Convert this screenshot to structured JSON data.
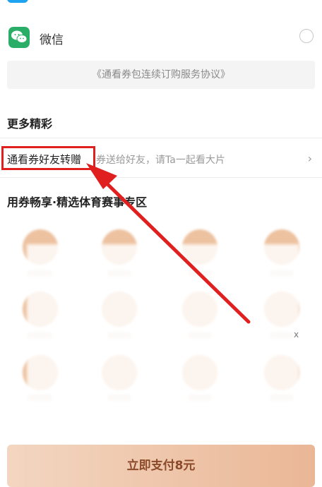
{
  "payment": {
    "wechat_label": "微信",
    "agreement_text": "《通看券包连续订购服务协议》"
  },
  "more": {
    "title": "更多精彩",
    "gift_title": "通看券好友转赠",
    "gift_desc": "券送给好友，请Ta一起看大片"
  },
  "sports": {
    "title": "用券畅享·精选体育赛事专区",
    "side_mark": "x"
  },
  "pay_button": {
    "label": "立即支付8元"
  },
  "colors": {
    "accent": "#e01f1f",
    "wechat": "#2aae67",
    "button": "#eab796"
  },
  "icons": {
    "wechat": "wechat-icon",
    "chevron": "chevron-right-icon",
    "radio": "radio-button",
    "annotation": "red-arrow"
  }
}
